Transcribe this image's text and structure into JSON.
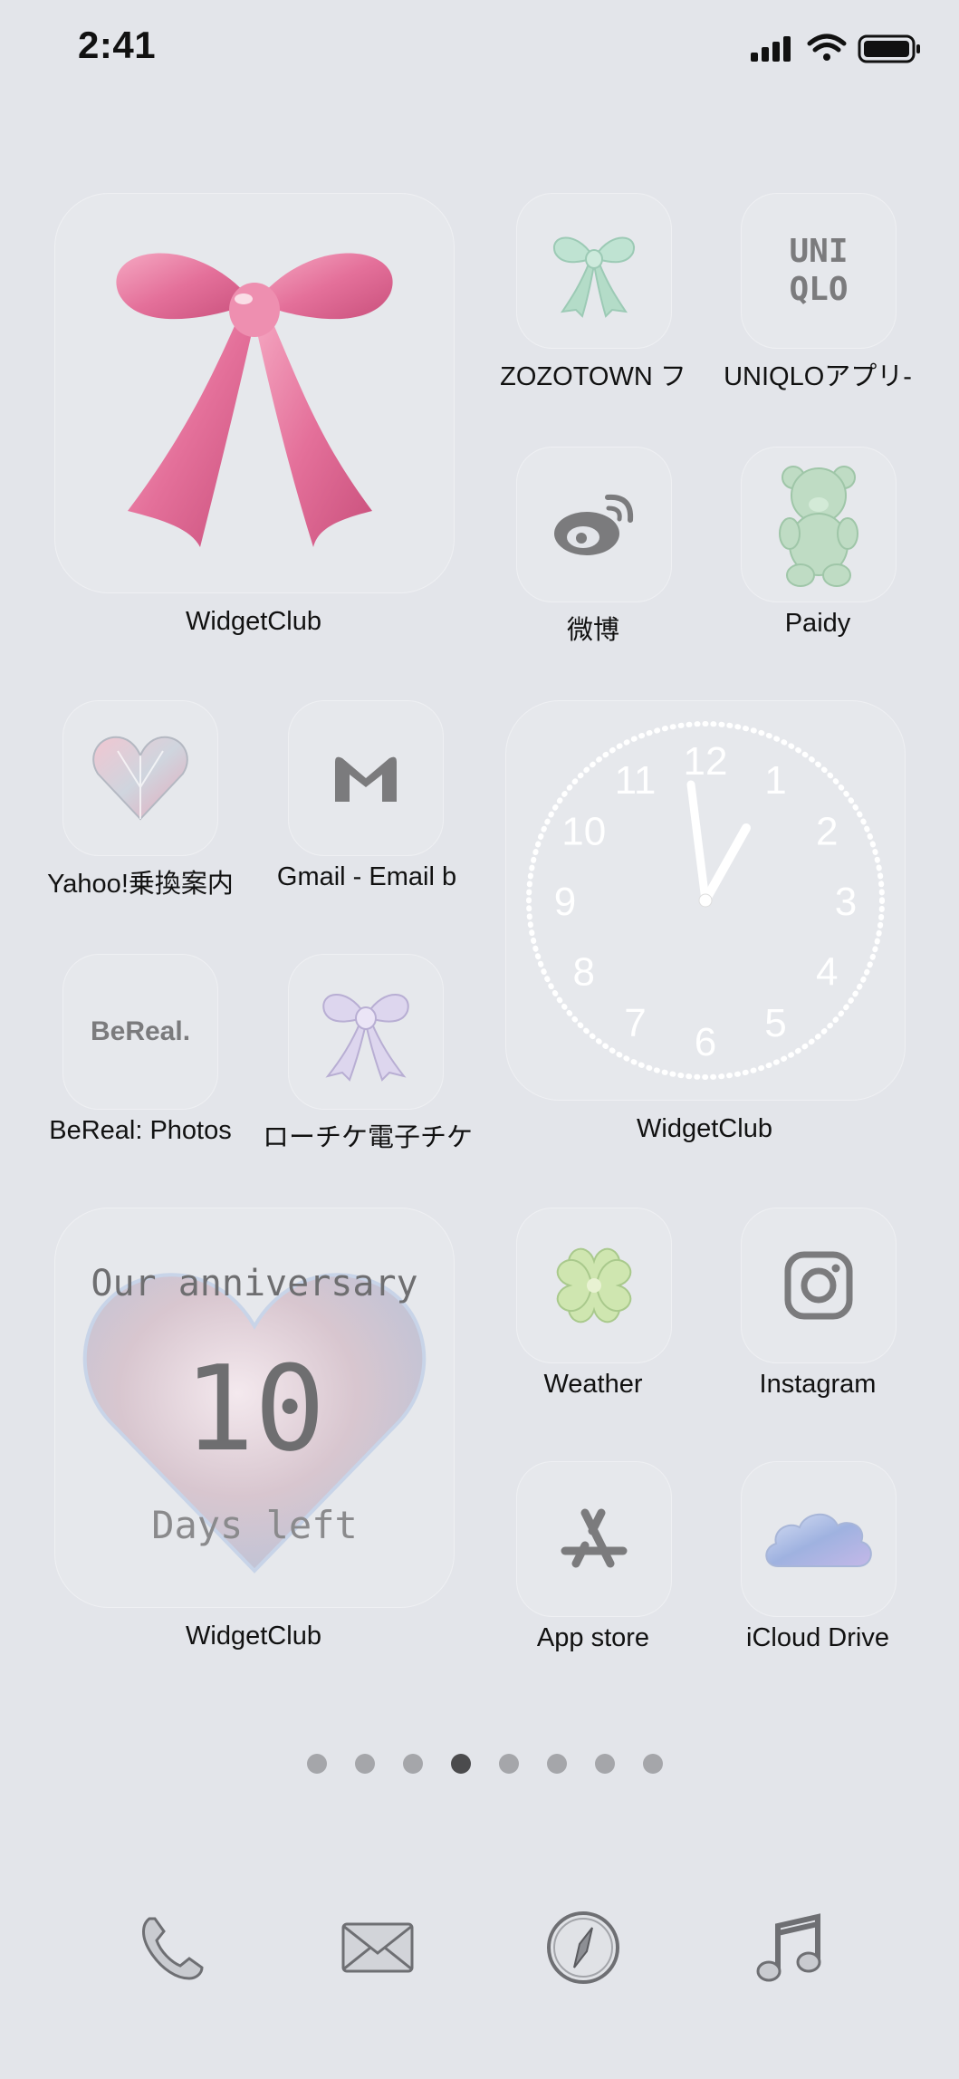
{
  "status_bar": {
    "time": "2:41"
  },
  "page1": {
    "widget_ribbon_label": "WidgetClub",
    "apps_row1": [
      {
        "label": "ZOZOTOWN フ",
        "icon": "ribbon-mint-icon"
      },
      {
        "label": "UNIQLOアプリ-",
        "icon": "uniqlo-logo-icon",
        "logo_text_1": "UNI",
        "logo_text_2": "QLO"
      }
    ],
    "apps_row2": [
      {
        "label": "微博",
        "icon": "weibo-icon"
      },
      {
        "label": "Paidy",
        "icon": "gummy-bear-icon"
      }
    ]
  },
  "page2": {
    "apps_row1": [
      {
        "label": "Yahoo!乗換案内",
        "icon": "crystal-heart-icon"
      },
      {
        "label": "Gmail - Email b",
        "icon": "gmail-m-icon"
      }
    ],
    "apps_row2": [
      {
        "label": "BeReal: Photos",
        "icon": "bereal-logo-icon",
        "logo_text": "BeReal."
      },
      {
        "label": "ローチケ電子チケ",
        "icon": "ribbon-lilac-icon"
      }
    ],
    "clock_widget_label": "WidgetClub",
    "clock_numbers": [
      "12",
      "1",
      "2",
      "3",
      "4",
      "5",
      "6",
      "7",
      "8",
      "9",
      "10",
      "11"
    ]
  },
  "page3": {
    "anniversary_widget": {
      "label": "WidgetClub",
      "title": "Our anniversary",
      "days": "10",
      "subtitle": "Days left"
    },
    "apps_row1": [
      {
        "label": "Weather",
        "icon": "clover-icon"
      },
      {
        "label": "Instagram",
        "icon": "instagram-icon"
      }
    ],
    "apps_row2": [
      {
        "label": "App store",
        "icon": "app-store-icon"
      },
      {
        "label": "iCloud Drive",
        "icon": "cloud-icon"
      }
    ]
  },
  "page_indicator": {
    "count": 8,
    "active_index": 3
  },
  "dock": [
    "phone-icon",
    "mail-icon",
    "safari-compass-icon",
    "music-note-icon"
  ],
  "colors": {
    "background": "#e3e5ea",
    "pink_ribbon": "#e8749a",
    "mint": "#b7dccb",
    "gray_icon": "#7b7b7d"
  }
}
